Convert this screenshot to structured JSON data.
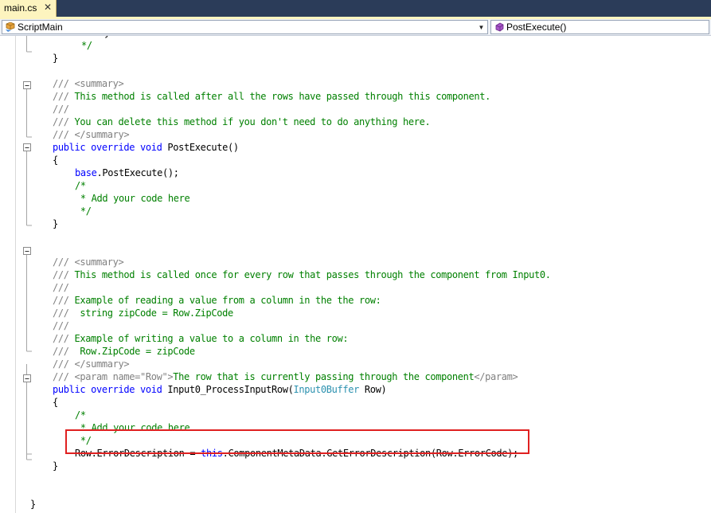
{
  "tab": {
    "title": "main.cs",
    "close": "✕"
  },
  "nav": {
    "left": {
      "icon": "csharp-class-icon",
      "label": "ScriptMain"
    },
    "right": {
      "icon": "method-icon",
      "label": "PostExecute()"
    }
  },
  "code": [
    [
      [
        "t",
        "    Add your code here"
      ]
    ],
    [
      [
        "cm",
        "*/"
      ]
    ],
    [
      [
        "t",
        "}"
      ]
    ],
    [],
    [
      [
        "cmg",
        "///"
      ],
      [
        "cm",
        " "
      ],
      [
        "cmg",
        "<summary>"
      ]
    ],
    [
      [
        "cmg",
        "///"
      ],
      [
        "cm",
        " This method is called after all the rows have passed through this component."
      ]
    ],
    [
      [
        "cmg",
        "///"
      ]
    ],
    [
      [
        "cmg",
        "///"
      ],
      [
        "cm",
        " You can delete this method if you don't need to do anything here."
      ]
    ],
    [
      [
        "cmg",
        "///"
      ],
      [
        "cm",
        " "
      ],
      [
        "cmg",
        "</summary>"
      ]
    ],
    [
      [
        "kw",
        "public override void "
      ],
      [
        "t",
        "PostExecute()"
      ]
    ],
    [
      [
        "t",
        "{"
      ]
    ],
    [
      [
        "kw",
        "base"
      ],
      [
        "t",
        ".PostExecute();"
      ]
    ],
    [
      [
        "cm",
        "/*"
      ]
    ],
    [
      [
        "cm",
        " * Add your code here"
      ]
    ],
    [
      [
        "cm",
        " */"
      ]
    ],
    [
      [
        "t",
        "}"
      ]
    ],
    [],
    [],
    [
      [
        "cmg",
        "///"
      ],
      [
        "cm",
        " "
      ],
      [
        "cmg",
        "<summary>"
      ]
    ],
    [
      [
        "cmg",
        "///"
      ],
      [
        "cm",
        " This method is called once for every row that passes through the component from Input0."
      ]
    ],
    [
      [
        "cmg",
        "///"
      ]
    ],
    [
      [
        "cmg",
        "///"
      ],
      [
        "cm",
        " Example of reading a value from a column in the the row:"
      ]
    ],
    [
      [
        "cmg",
        "///"
      ],
      [
        "cm",
        "  string zipCode = Row.ZipCode"
      ]
    ],
    [
      [
        "cmg",
        "///"
      ]
    ],
    [
      [
        "cmg",
        "///"
      ],
      [
        "cm",
        " Example of writing a value to a column in the row:"
      ]
    ],
    [
      [
        "cmg",
        "///"
      ],
      [
        "cm",
        "  Row.ZipCode = zipCode"
      ]
    ],
    [
      [
        "cmg",
        "///"
      ],
      [
        "cm",
        " "
      ],
      [
        "cmg",
        "</summary>"
      ]
    ],
    [
      [
        "cmg",
        "///"
      ],
      [
        "cm",
        " "
      ],
      [
        "cmg",
        "<param name=\"Row\">"
      ],
      [
        "cm",
        "The row that is currently passing through the component"
      ],
      [
        "cmg",
        "</param>"
      ]
    ],
    [
      [
        "kw",
        "public override void "
      ],
      [
        "t",
        "Input0_ProcessInputRow("
      ],
      [
        "ty",
        "Input0Buffer"
      ],
      [
        "t",
        " Row)"
      ]
    ],
    [
      [
        "t",
        "{"
      ]
    ],
    [
      [
        "cm",
        "/*"
      ]
    ],
    [
      [
        "cm",
        " * Add your code here"
      ]
    ],
    [
      [
        "cm",
        " */"
      ]
    ],
    [
      [
        "t",
        "Row.ErrorDescription = "
      ],
      [
        "kw",
        "this"
      ],
      [
        "t",
        ".ComponentMetaData.GetErrorDescription(Row.ErrorCode);"
      ]
    ],
    [
      [
        "t",
        "}"
      ]
    ],
    [],
    [],
    [
      [
        "t",
        "}"
      ]
    ]
  ],
  "collapse_icon": "⊟"
}
